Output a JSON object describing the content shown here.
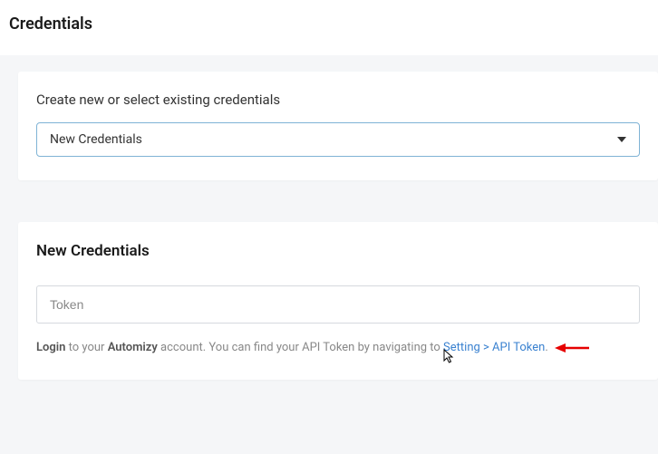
{
  "page": {
    "title": "Credentials"
  },
  "selectCard": {
    "label": "Create new or select existing credentials",
    "selectedValue": "New Credentials"
  },
  "newCredentials": {
    "heading": "New Credentials",
    "tokenPlaceholder": "Token",
    "helper": {
      "loginStrong": "Login",
      "text1": " to your ",
      "brandStrong": "Automizy",
      "text2": " account. You can find your API Token by navigating to ",
      "link": "Setting > API Token",
      "period": "."
    }
  }
}
